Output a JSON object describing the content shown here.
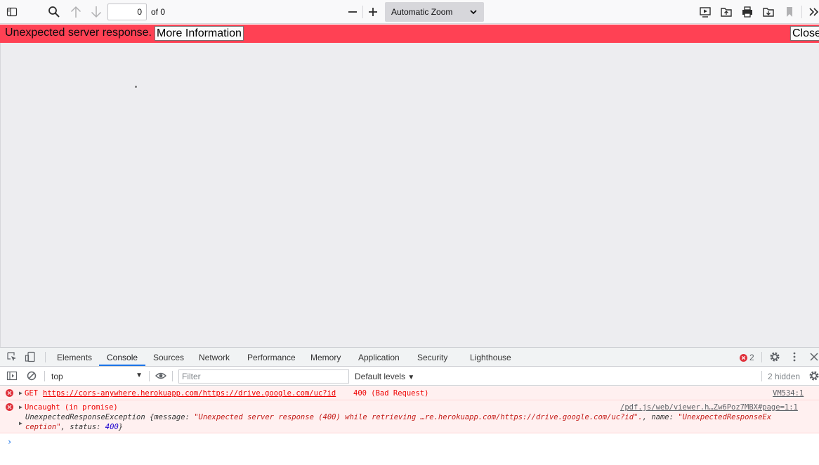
{
  "toolbar": {
    "page_value": "0",
    "page_of": "of 0",
    "zoom": "Automatic Zoom"
  },
  "error_bar": {
    "message": "Unexpected server response.",
    "more_info": "More Information",
    "close": "Close"
  },
  "devtools": {
    "tabs": [
      "Elements",
      "Console",
      "Sources",
      "Network",
      "Performance",
      "Memory",
      "Application",
      "Security",
      "Lighthouse"
    ],
    "error_count": "2",
    "context": "top",
    "filter_placeholder": "Filter",
    "levels": "Default levels",
    "hidden": "2 hidden",
    "messages": {
      "m1_method": "GET",
      "m1_url": "https://cors-anywhere.herokuapp.com/https://drive.google.com/uc?id",
      "m1_status": "400 (Bad Request)",
      "m1_source": "VM534:1",
      "m2_text": "Uncaught (in promise)",
      "m2_source": "/pdf.js/web/viewer.h…Zw6Poz7MBX#page=1:1",
      "m2_obj_a": "UnexpectedResponseException {message: ",
      "m2_msg_str": "\"Unexpected server response (400) while retrieving …re.herokuapp.com/https://drive.google.com/uc?id\".",
      "m2_obj_b": ", name: ",
      "m2_name_str": "\"UnexpectedResponseEx",
      "m2_line2_str": "ception\"",
      "m2_line2_b": ", status: ",
      "m2_status": "400",
      "m2_close": "}"
    }
  },
  "colors": {
    "error_bar": "#ff4154",
    "console_error_bg": "#fff0f0",
    "accent": "#1a73e8"
  }
}
